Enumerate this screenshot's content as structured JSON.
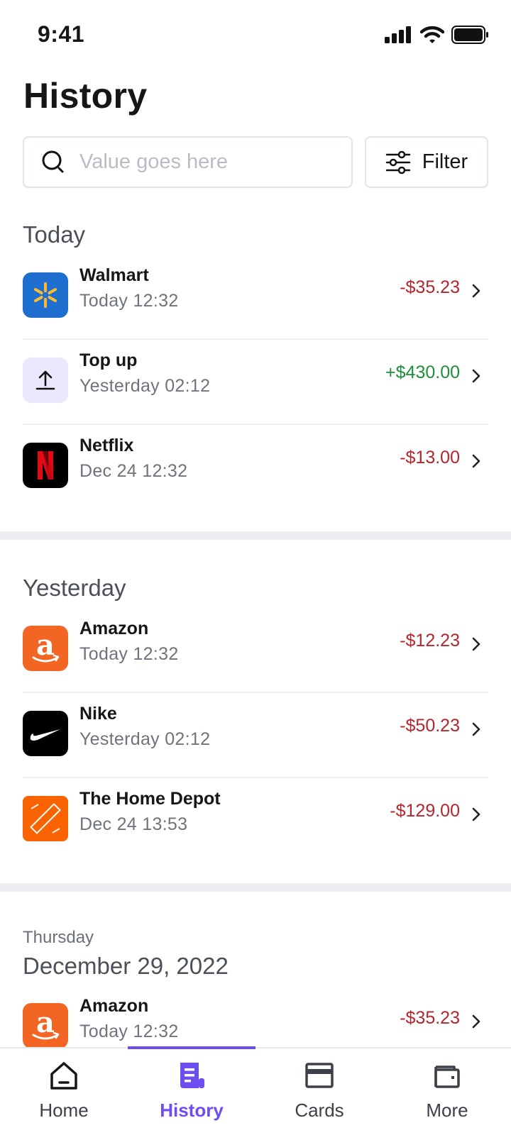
{
  "status_bar": {
    "time": "9:41"
  },
  "page_title": "History",
  "search": {
    "placeholder": "Value goes here",
    "value": ""
  },
  "filter": {
    "label": "Filter"
  },
  "colors": {
    "accent": "#6d4ef0",
    "negative": "#b3262d",
    "positive": "#1d8f3a"
  },
  "sections": [
    {
      "label": "Today",
      "rows": [
        {
          "name": "Walmart",
          "date": "Today  12:32",
          "amount": "-$35.23",
          "logo": "walmart-logo"
        },
        {
          "name": "Top up",
          "date": "Yesterday 02:12",
          "amount": "+$430.00",
          "logo": "upload-icon"
        },
        {
          "name": "Netflix",
          "date": "Dec 24 12:32",
          "amount": "-$13.00",
          "logo": "netflix-logo"
        }
      ]
    },
    {
      "label": "Yesterday",
      "rows": [
        {
          "name": "Amazon",
          "date": "Today  12:32",
          "amount": "-$12.23",
          "logo": "amazon-logo"
        },
        {
          "name": "Nike",
          "date": "Yesterday 02:12",
          "amount": "-$50.23",
          "logo": "nike-logo"
        },
        {
          "name": "The Home Depot",
          "date": "Dec 24 13:53",
          "amount": "-$129.00",
          "logo": "home-depot-logo"
        }
      ]
    },
    {
      "sublabel": "Thursday",
      "label": "December 29, 2022",
      "rows": [
        {
          "name": "Amazon",
          "date": "Today  12:32",
          "amount": "-$35.23",
          "logo": "amazon-logo"
        }
      ]
    }
  ],
  "tabs": [
    {
      "label": "Home",
      "icon": "home-icon",
      "active": false
    },
    {
      "label": "History",
      "icon": "history-icon",
      "active": true
    },
    {
      "label": "Cards",
      "icon": "card-icon",
      "active": false
    },
    {
      "label": "More",
      "icon": "wallet-icon",
      "active": false
    }
  ]
}
